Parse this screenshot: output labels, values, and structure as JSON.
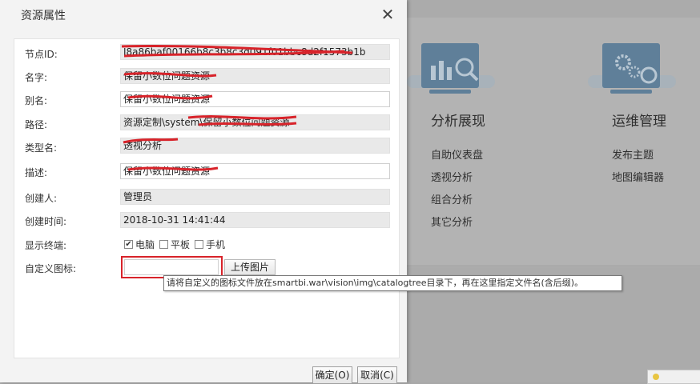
{
  "dialog": {
    "title": "资源属性",
    "close_icon": "close-icon",
    "fields": {
      "node_id": {
        "label": "节点ID:",
        "value": "I8a86baf00166b8c3b8c3d091f01bbc8d2f1573b1b"
      },
      "name": {
        "label": "名字:",
        "value": "保留小数位问题资源"
      },
      "alias": {
        "label": "别名:",
        "value": "保留小数位问题资源"
      },
      "path": {
        "label": "路径:",
        "value": "资源定制\\system\\保留小数位问题资源"
      },
      "type_name": {
        "label": "类型名:",
        "value": "透视分析"
      },
      "description": {
        "label": "描述:",
        "value": "保留小数位问题资源"
      },
      "creator": {
        "label": "创建人:",
        "value": "管理员"
      },
      "created_time": {
        "label": "创建时间:",
        "value": "2018-10-31 14:41:44"
      }
    },
    "display_terminal": {
      "label": "显示终端:",
      "options": [
        {
          "label": "电脑",
          "checked": true
        },
        {
          "label": "平板",
          "checked": false
        },
        {
          "label": "手机",
          "checked": false
        }
      ]
    },
    "custom_icon": {
      "label": "自定义图标:",
      "value": "",
      "upload_label": "上传图片"
    },
    "tooltip": "请将自定义的图标文件放在smartbi.war\\vision\\img\\catalogtree目录下，再在这里指定文件名(含后缀)。",
    "ok_label": "确定(O)",
    "cancel_label": "取消(C)"
  },
  "background": {
    "sections": [
      {
        "title": "分析展现",
        "icon": "analysis-chart-icon",
        "links": [
          "自助仪表盘",
          "透视分析",
          "组合分析",
          "其它分析"
        ]
      },
      {
        "title": "运维管理",
        "icon": "gears-monitor-icon",
        "links": [
          "发布主题",
          "地图编辑器"
        ]
      }
    ]
  },
  "colors": {
    "annotation_red": "#d8232a",
    "dialog_bg": "#f3f3f3",
    "overlay_bg": "#ababab"
  }
}
